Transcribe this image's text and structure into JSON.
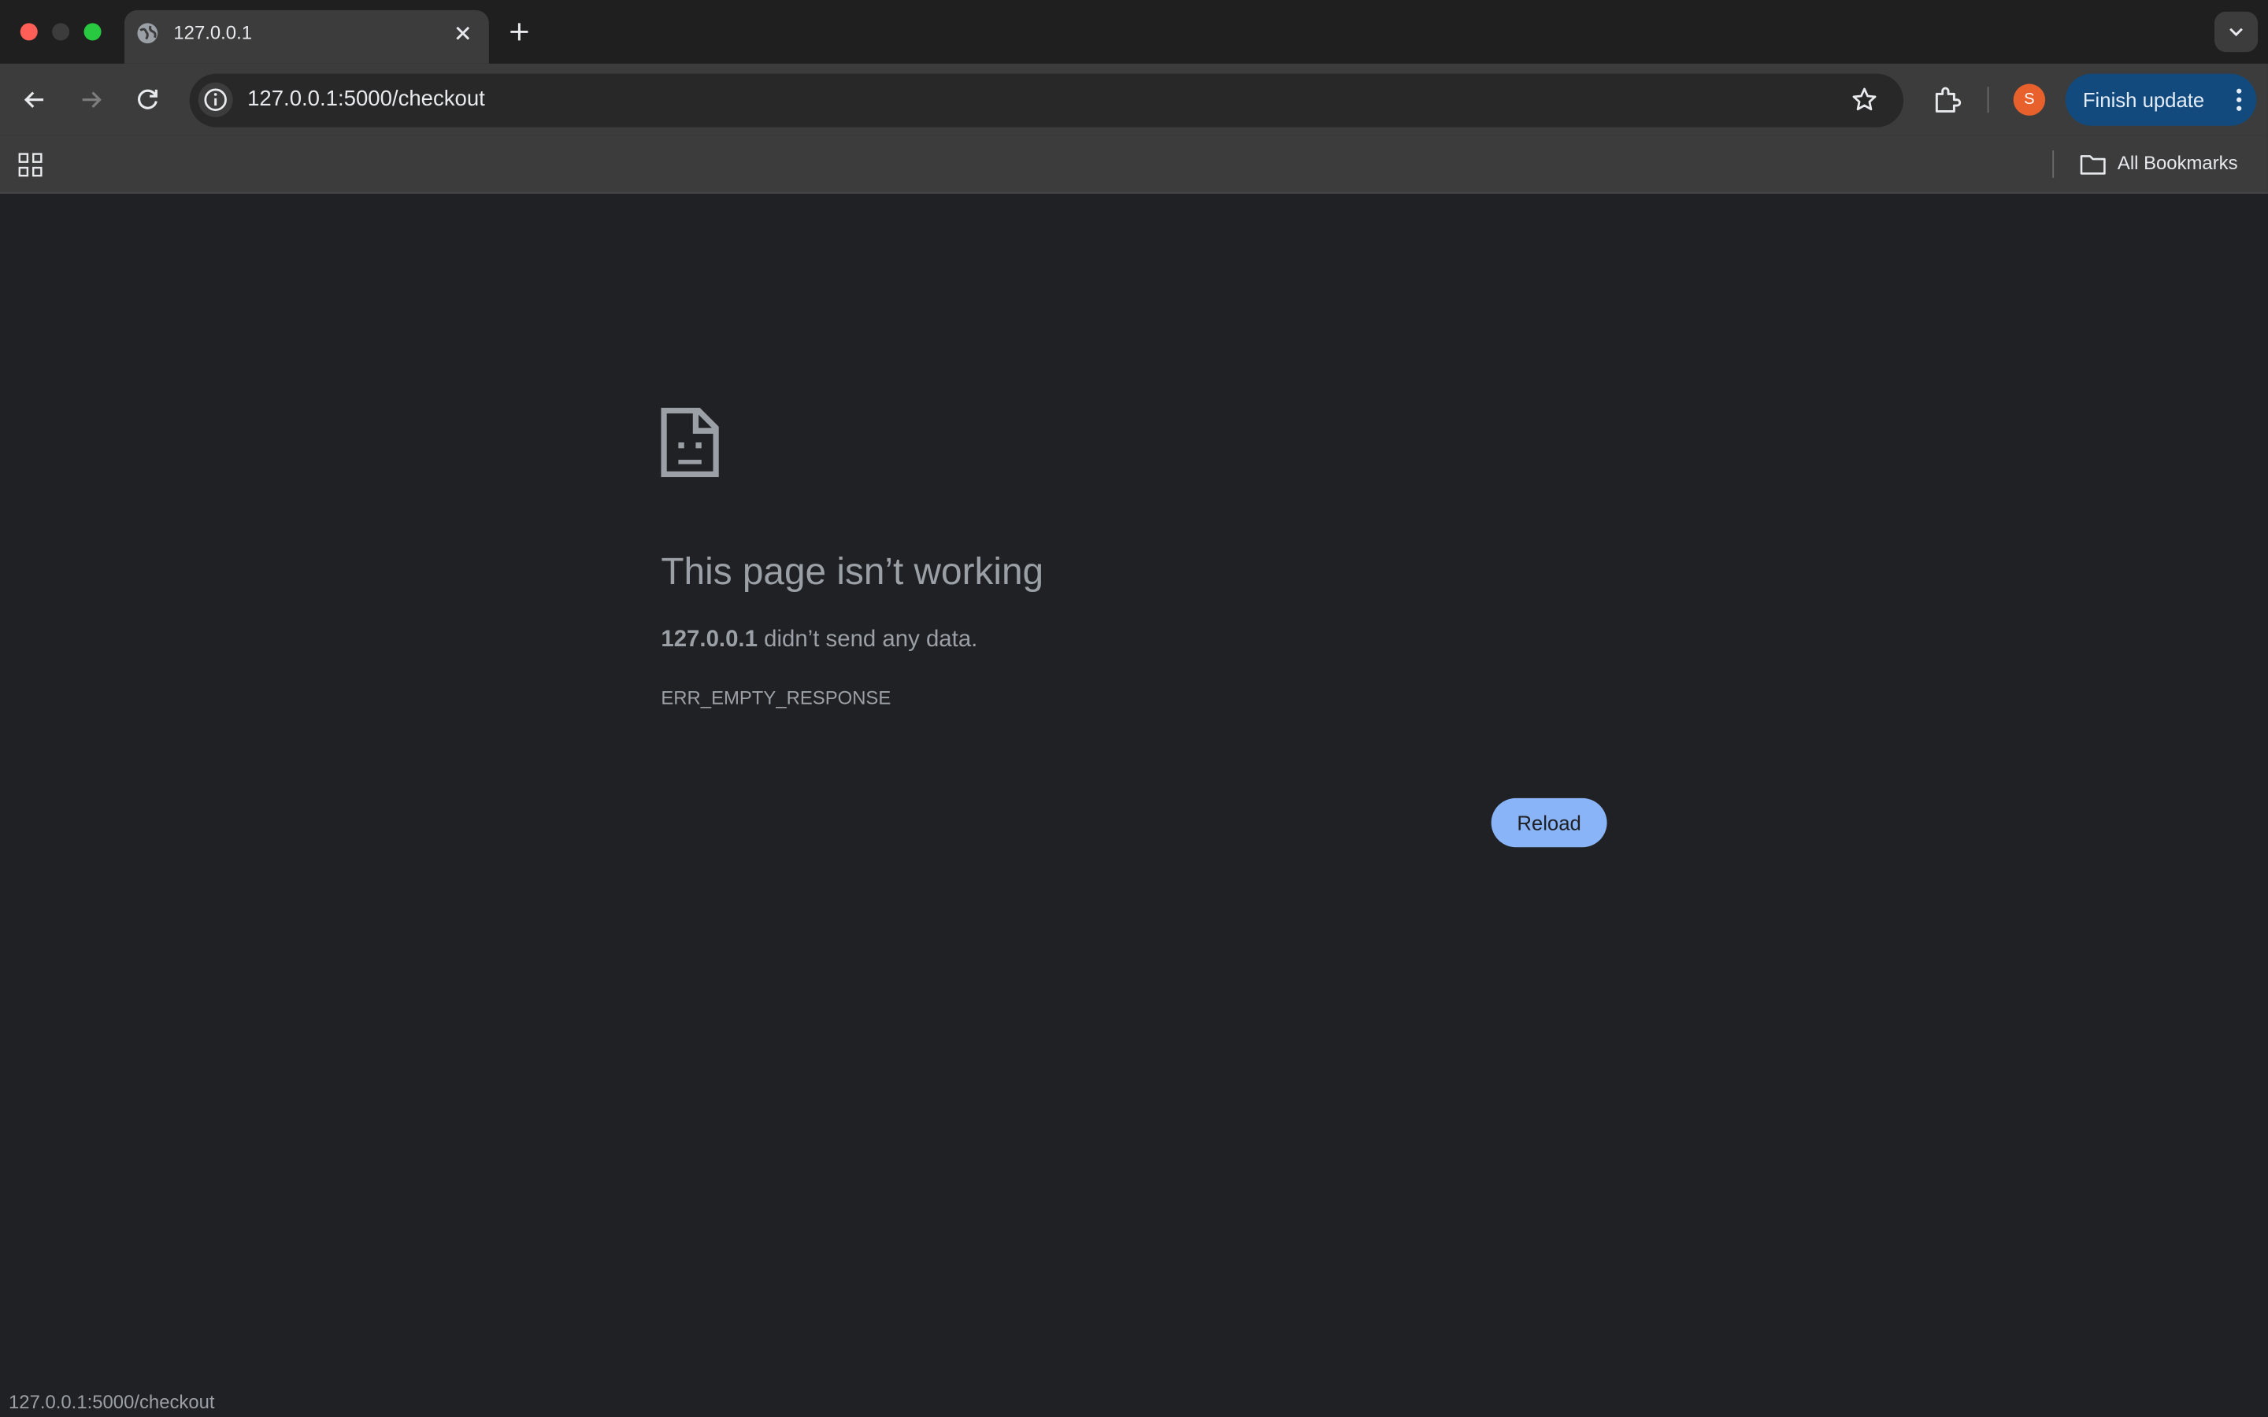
{
  "browser": {
    "tab": {
      "title": "127.0.0.1",
      "favicon": "globe-icon"
    },
    "toolbar": {
      "url": "127.0.0.1:5000/checkout",
      "profile_initial": "S",
      "profile_color": "#e8602c",
      "finish_update_label": "Finish update",
      "finish_update_color": "#124a7d"
    },
    "bookmarks_bar": {
      "all_bookmarks_label": "All Bookmarks"
    }
  },
  "error_page": {
    "heading": "This page isn’t working",
    "host": "127.0.0.1",
    "description_rest": " didn’t send any data.",
    "error_code": "ERR_EMPTY_RESPONSE",
    "reload_label": "Reload",
    "reload_color": "#8ab4f8"
  },
  "status_bar": {
    "text": "127.0.0.1:5000/checkout"
  }
}
